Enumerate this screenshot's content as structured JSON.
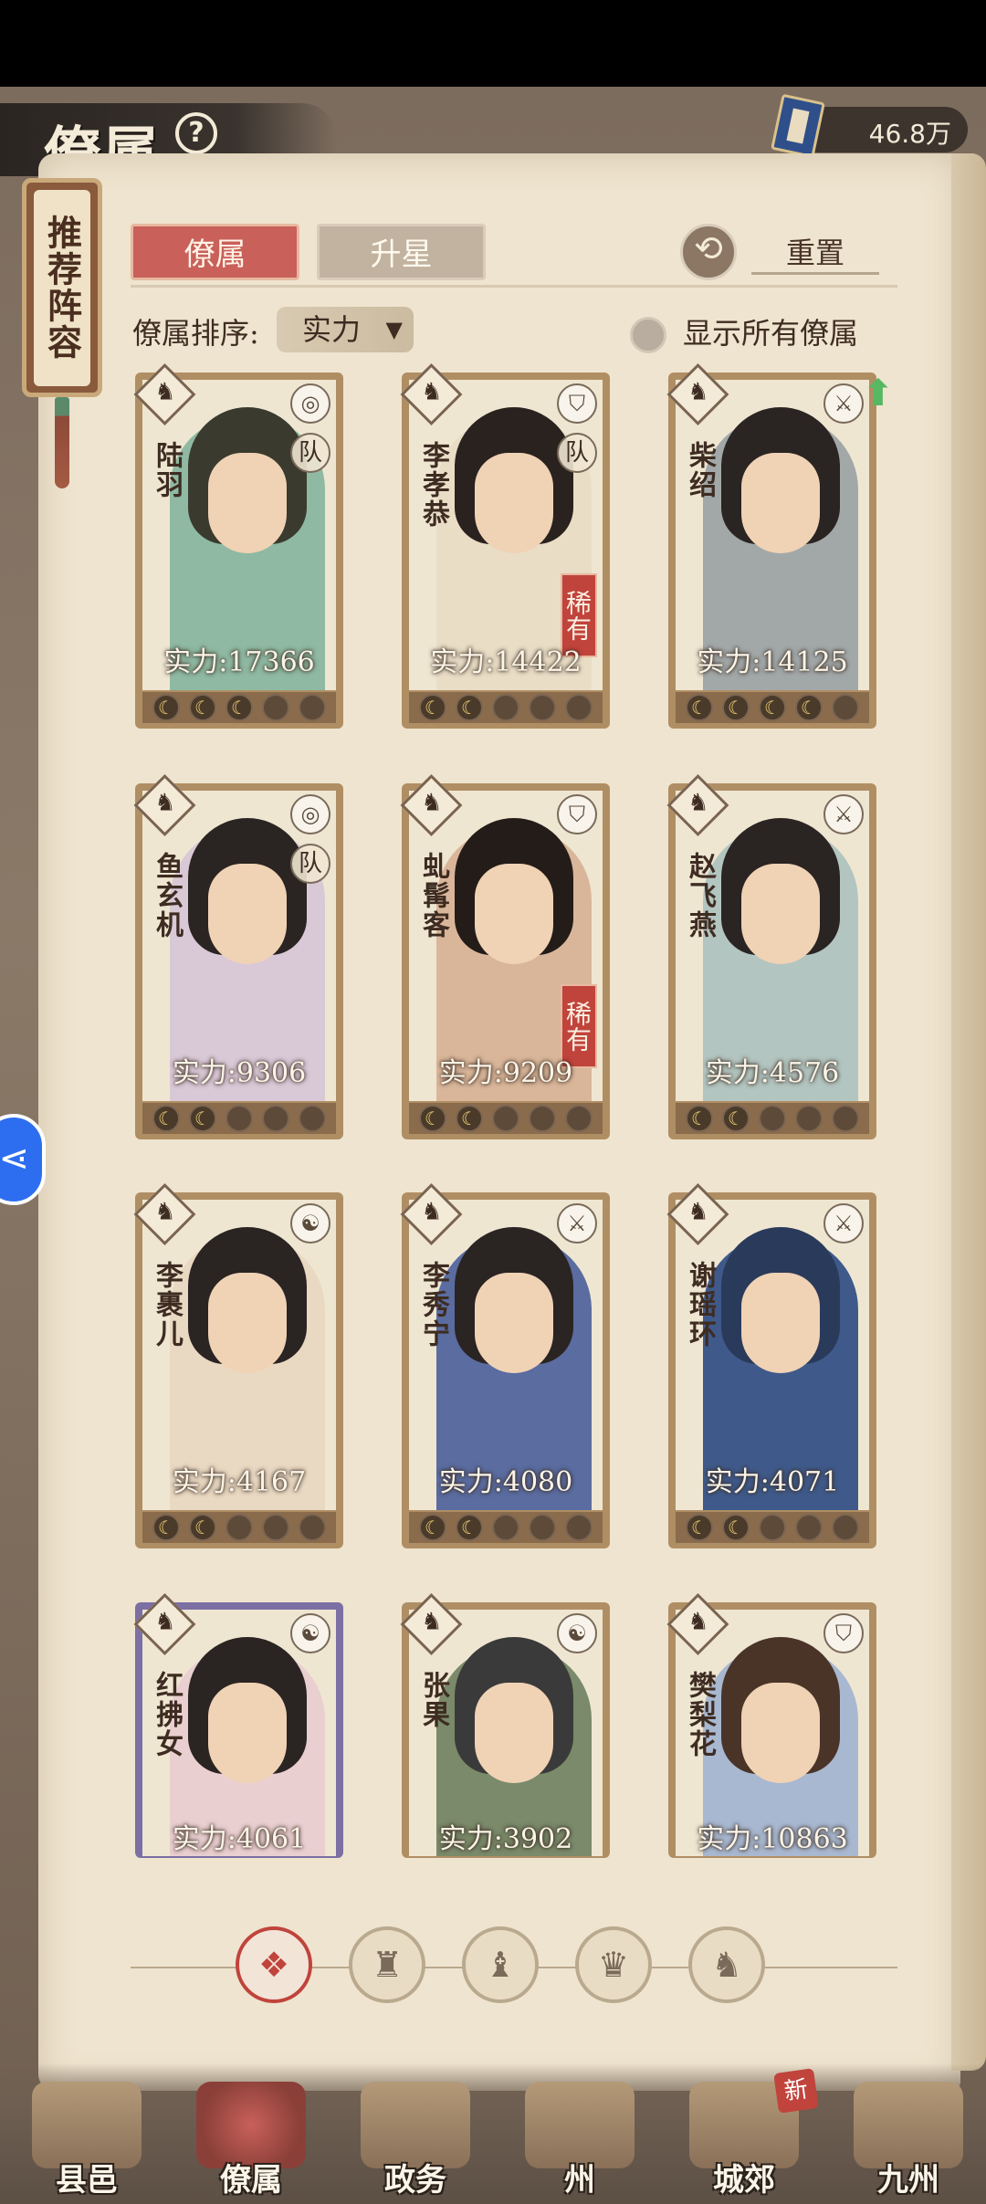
{
  "header": {
    "title": "僚属",
    "help_icon": "?",
    "currency_value": "46.8万",
    "currency_icon": "book-icon"
  },
  "recommend_tag": "推荐阵容",
  "tabs": [
    {
      "label": "僚属",
      "active": true
    },
    {
      "label": "升星",
      "active": false
    }
  ],
  "reset_label": "重置",
  "sort": {
    "label": "僚属排序:",
    "selected": "实力",
    "caret": "▼"
  },
  "toggle_label": "显示所有僚属",
  "cards": [
    {
      "name": "陆羽",
      "power": "实力:17366",
      "stars_on": 3,
      "stars_total": 5,
      "team": "队",
      "rare": "",
      "class_icon": "ring-icon",
      "hair": "#3a3a2e",
      "robe": "#8fb9a2"
    },
    {
      "name": "李孝恭",
      "power": "实力:14422",
      "stars_on": 2,
      "stars_total": 5,
      "team": "队",
      "rare": "稀有",
      "class_icon": "shield-icon",
      "hair": "#2a221e",
      "robe": "#e9ddc6"
    },
    {
      "name": "柴绍",
      "power": "实力:14125",
      "stars_on": 4,
      "stars_total": 5,
      "team": "",
      "rare": "",
      "class_icon": "sword-icon",
      "hair": "#2a2422",
      "robe": "#a2a8a8"
    },
    {
      "name": "鱼玄机",
      "power": "实力:9306",
      "stars_on": 2,
      "stars_total": 5,
      "team": "队",
      "rare": "",
      "class_icon": "ring-icon",
      "hair": "#2a2422",
      "robe": "#d9c8d6"
    },
    {
      "name": "虬髯客",
      "power": "实力:9209",
      "stars_on": 2,
      "stars_total": 5,
      "team": "",
      "rare": "稀有",
      "class_icon": "shield-icon",
      "hair": "#241c18",
      "robe": "#d9b69a"
    },
    {
      "name": "赵飞燕",
      "power": "实力:4576",
      "stars_on": 2,
      "stars_total": 5,
      "team": "",
      "rare": "",
      "class_icon": "sword-icon",
      "hair": "#2a2422",
      "robe": "#b3c5c0"
    },
    {
      "name": "李裹儿",
      "power": "实力:4167",
      "stars_on": 2,
      "stars_total": 5,
      "team": "",
      "rare": "",
      "class_icon": "yin-yang-icon",
      "hair": "#2a2422",
      "robe": "#e9d9c2"
    },
    {
      "name": "李秀宁",
      "power": "实力:4080",
      "stars_on": 2,
      "stars_total": 5,
      "team": "",
      "rare": "",
      "class_icon": "sword-icon",
      "hair": "#2a2422",
      "robe": "#5a6ca0"
    },
    {
      "name": "谢瑶环",
      "power": "实力:4071",
      "stars_on": 2,
      "stars_total": 5,
      "team": "",
      "rare": "",
      "class_icon": "sword-icon",
      "hair": "#2a3a5a",
      "robe": "#3f5a8a"
    },
    {
      "name": "红拂女",
      "power": "实力:4061",
      "stars_on": 0,
      "stars_total": 5,
      "team": "",
      "rare": "",
      "class_icon": "yin-yang-icon",
      "hair": "#2a2422",
      "robe": "#e9cfd0"
    },
    {
      "name": "张果",
      "power": "实力:3902",
      "stars_on": 0,
      "stars_total": 5,
      "team": "",
      "rare": "",
      "class_icon": "yin-yang-icon",
      "hair": "#3a3a3a",
      "robe": "#7a8a6a"
    },
    {
      "name": "樊梨花",
      "power": "实力:10863",
      "stars_on": 0,
      "stars_total": 5,
      "team": "",
      "rare": "",
      "class_icon": "shield-icon",
      "hair": "#4a3428",
      "robe": "#a8b8d0"
    }
  ],
  "filters": [
    {
      "icon": "all-icon",
      "glyph": "❖",
      "active": true
    },
    {
      "icon": "bell-icon",
      "glyph": "♜",
      "active": false
    },
    {
      "icon": "gourd-icon",
      "glyph": "♝",
      "active": false
    },
    {
      "icon": "fan-icon",
      "glyph": "♛",
      "active": false
    },
    {
      "icon": "horse-icon",
      "glyph": "♞",
      "active": false
    }
  ],
  "nav": [
    {
      "label": "县邑",
      "active": false,
      "badge": ""
    },
    {
      "label": "僚属",
      "active": true,
      "badge": ""
    },
    {
      "label": "政务",
      "active": false,
      "badge": ""
    },
    {
      "label": "州",
      "active": false,
      "badge": ""
    },
    {
      "label": "城郊",
      "active": false,
      "badge": "新"
    },
    {
      "label": "九州",
      "active": false,
      "badge": ""
    }
  ],
  "side_float_glyph": "⋖"
}
